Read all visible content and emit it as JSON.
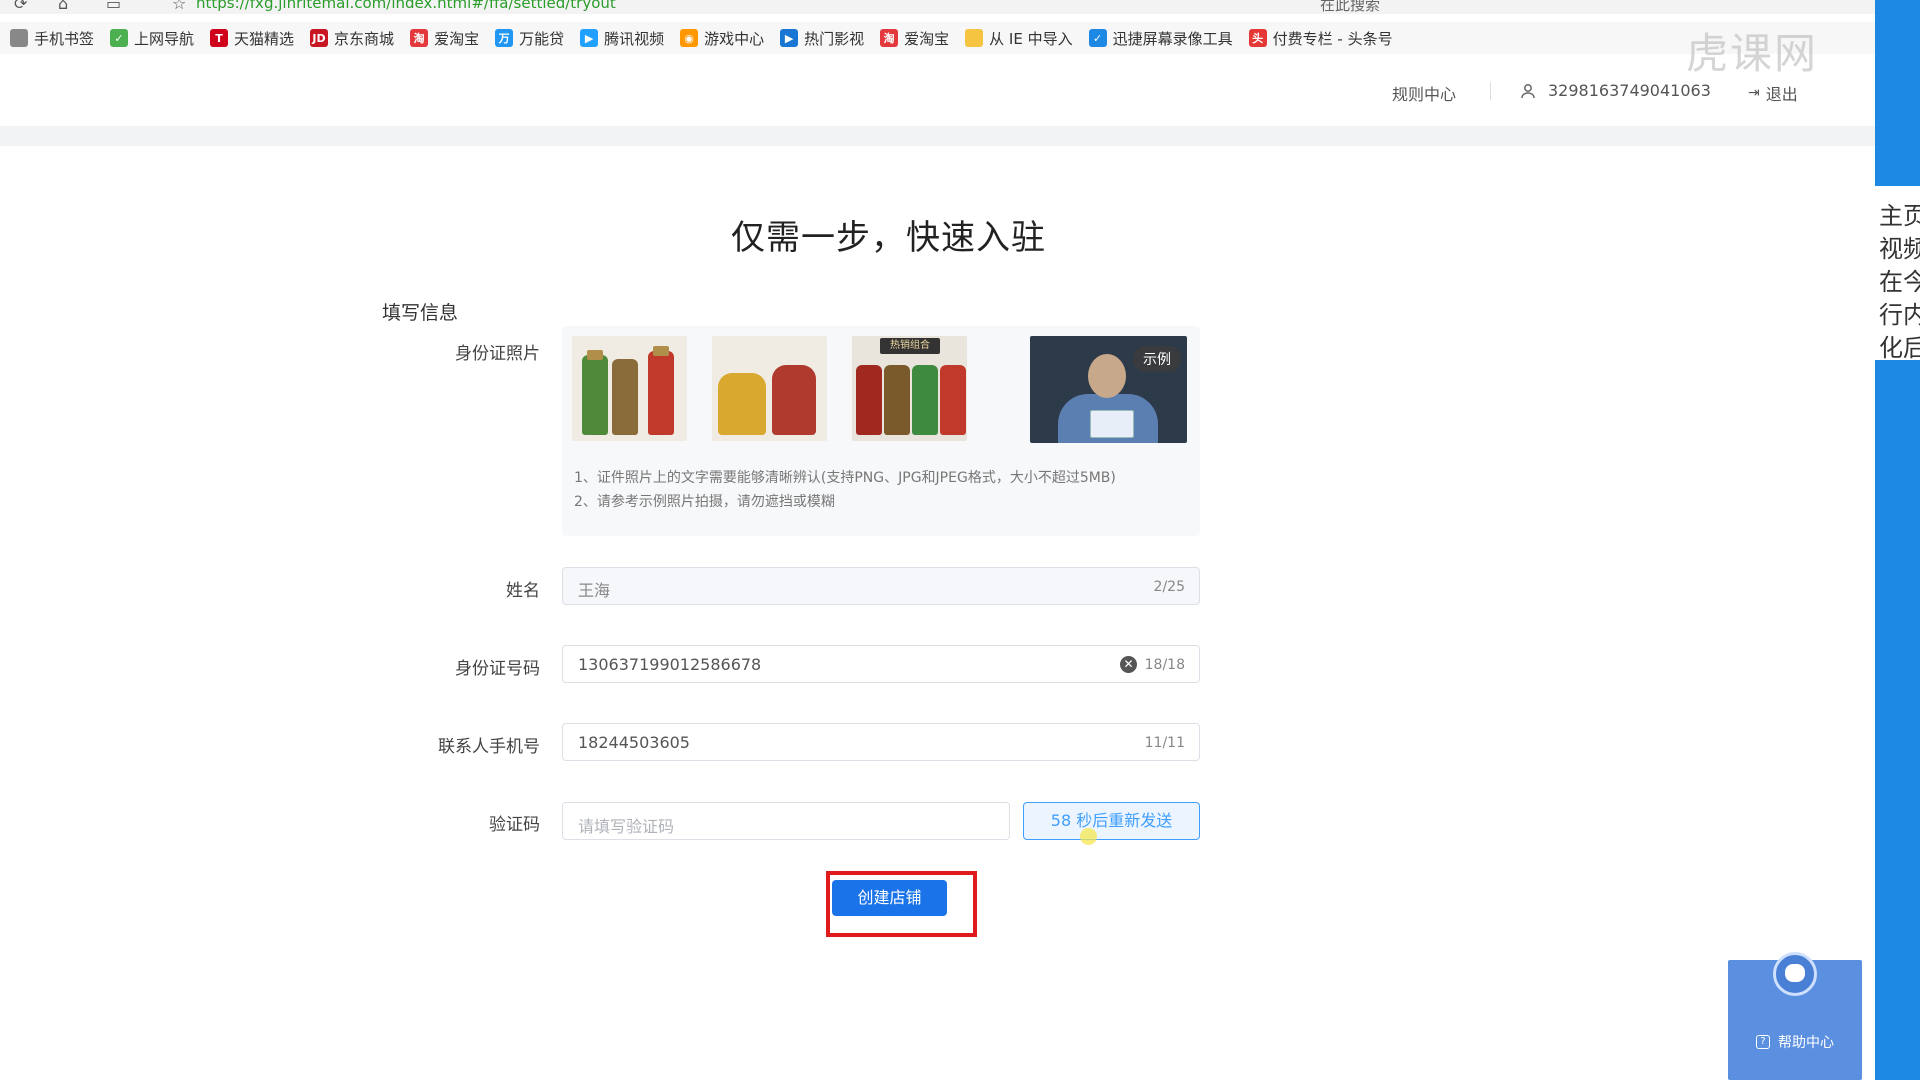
{
  "browser": {
    "url_prefix": "https://",
    "url_rest": "fxg.jinritemai.com/index.html#/ffa/settled/tryout",
    "search_text": "在此搜索"
  },
  "bookmarks": [
    {
      "label": "手机书签",
      "icon": "phone-bookmark-icon",
      "color": "#888888",
      "glyph": ""
    },
    {
      "label": "上网导航",
      "icon": "hao-nav-icon",
      "color": "#4caf50",
      "glyph": "✓"
    },
    {
      "label": "天猫精选",
      "icon": "tmall-icon",
      "color": "#d0021b",
      "glyph": "T"
    },
    {
      "label": "京东商城",
      "icon": "jd-icon",
      "color": "#c91623",
      "glyph": "JD"
    },
    {
      "label": "爱淘宝",
      "icon": "aitaobao-icon",
      "color": "#e4393c",
      "glyph": "淘"
    },
    {
      "label": "万能贷",
      "icon": "wannengdai-icon",
      "color": "#2196f3",
      "glyph": "万"
    },
    {
      "label": "腾讯视频",
      "icon": "tencent-video-icon",
      "color": "#20a0ff",
      "glyph": "▶"
    },
    {
      "label": "游戏中心",
      "icon": "game-center-icon",
      "color": "#ff9800",
      "glyph": "◉"
    },
    {
      "label": "热门影视",
      "icon": "hot-video-icon",
      "color": "#1976d2",
      "glyph": "▶"
    },
    {
      "label": "爱淘宝",
      "icon": "aitaobao-icon",
      "color": "#e4393c",
      "glyph": "淘"
    },
    {
      "label": "从 IE 中导入",
      "icon": "folder-icon",
      "color": "#f5c542",
      "glyph": ""
    },
    {
      "label": "迅捷屏幕录像工具",
      "icon": "shield-icon",
      "color": "#1e88e5",
      "glyph": "✓"
    },
    {
      "label": "付费专栏 - 头条号",
      "icon": "toutiao-icon",
      "color": "#e53935",
      "glyph": "头"
    }
  ],
  "header": {
    "rules_label": "规则中心",
    "user_id": "3298163749041063",
    "logout_label": "退出"
  },
  "page": {
    "title": "仅需一步，快速入驻",
    "section_title": "填写信息"
  },
  "form": {
    "id_photo_label": "身份证照片",
    "example_tag": "示例",
    "product_banner": "热销组合",
    "hints": [
      "1、证件照片上的文字需要能够清晰辨认(支持PNG、JPG和JPEG格式，大小不超过5MB)",
      "2、请参考示例照片拍摄，请勿遮挡或模糊"
    ],
    "name_label": "姓名",
    "name_value": "王海",
    "name_count": "2/25",
    "id_label": "身份证号码",
    "id_value": "130637199012586678",
    "id_count": "18/18",
    "phone_label": "联系人手机号",
    "phone_value": "18244503605",
    "phone_count": "11/11",
    "code_label": "验证码",
    "code_placeholder": "请填写验证码",
    "resend_label": "58 秒后重新发送",
    "submit_label": "创建店铺"
  },
  "side_tip": [
    "主页",
    "视频",
    "在今",
    "行内",
    "化后"
  ],
  "help": {
    "label": "帮助中心"
  },
  "watermark": "虎课网",
  "colors": {
    "primary": "#1a73e8",
    "highlight": "#e01b1b",
    "edge": "#1e88e5"
  }
}
